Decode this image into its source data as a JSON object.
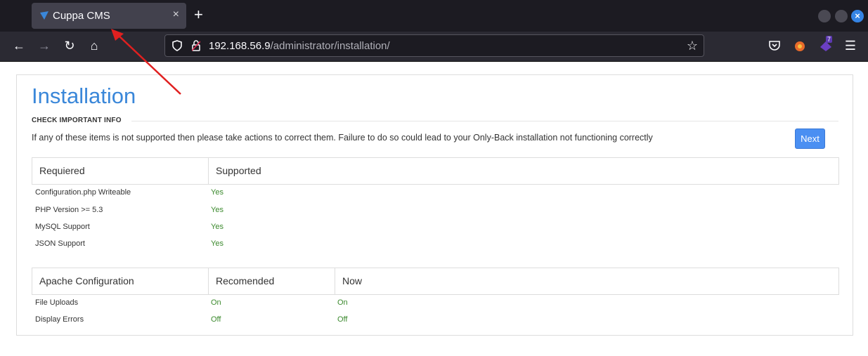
{
  "browser": {
    "tab_title": "Cuppa CMS",
    "tab_close": "×",
    "new_tab": "+",
    "url_host": "192.168.56.9",
    "url_path": "/administrator/installation/",
    "extension_badge": "7",
    "window_close": "×"
  },
  "page": {
    "title": "Installation",
    "section": "CHECK IMPORTANT INFO",
    "info": "If any of these items is not supported then please take actions to correct them. Failure to do so could lead to your Only-Back installation not functioning correctly",
    "next_label": "Next",
    "requirements": {
      "headers": [
        "Requiered",
        "Supported"
      ],
      "rows": [
        {
          "name": "Configuration.php Writeable",
          "value": "Yes"
        },
        {
          "name": "PHP Version >= 5.3",
          "value": "Yes"
        },
        {
          "name": "MySQL Support",
          "value": "Yes"
        },
        {
          "name": "JSON Support",
          "value": "Yes"
        }
      ]
    },
    "apache": {
      "headers": [
        "Apache Configuration",
        "Recomended",
        "Now"
      ],
      "rows": [
        {
          "name": "File Uploads",
          "recommended": "On",
          "now": "On"
        },
        {
          "name": "Display Errors",
          "recommended": "Off",
          "now": "Off"
        }
      ]
    }
  },
  "colors": {
    "accent": "#3a87d9",
    "ok_green": "#3c8a2e",
    "button": "#4a8ff2",
    "annotation": "#e02020"
  }
}
